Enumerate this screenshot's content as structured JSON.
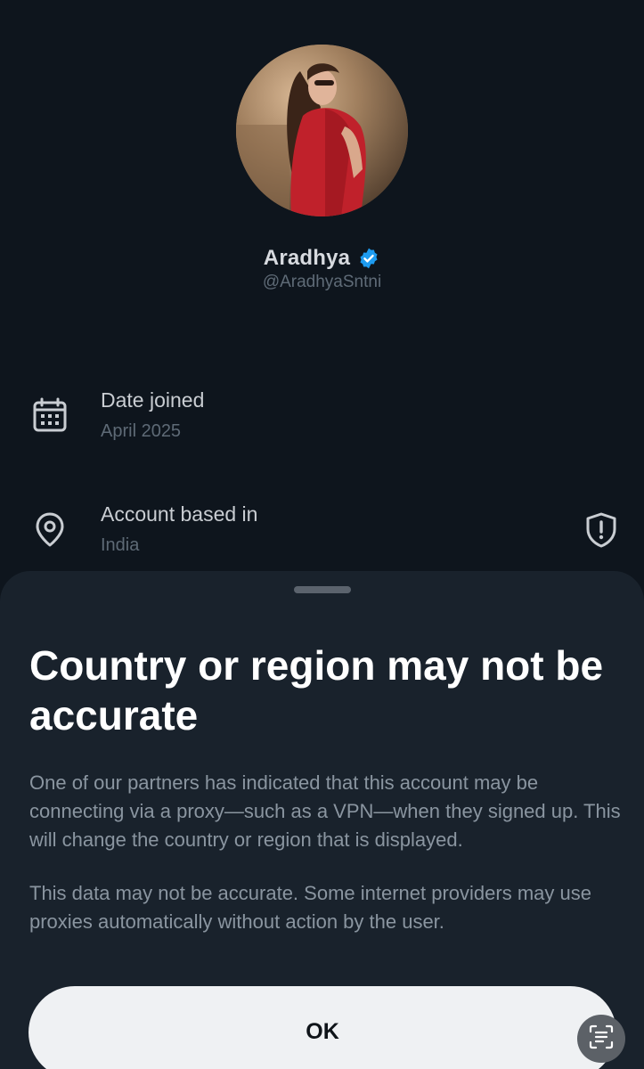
{
  "profile": {
    "name": "Aradhya",
    "handle": "@AradhyaSntni",
    "verified": true
  },
  "about": {
    "date_joined": {
      "title": "Date joined",
      "value": "April 2025",
      "icon": "calendar-icon"
    },
    "account_based_in": {
      "title": "Account based in",
      "value": "India",
      "icon": "location-pin-icon",
      "warning_icon": "shield-alert-icon"
    }
  },
  "sheet": {
    "title": "Country or region may not be accurate",
    "paragraph1": "One of our partners has indicated that this account may be connecting via a proxy—such as a VPN—when they signed up. This will change the country or region that is displayed.",
    "paragraph2": "This data may not be accurate. Some internet providers may use proxies automatically without action by the user.",
    "ok_label": "OK"
  },
  "overlay": {
    "lens_icon": "text-scan-icon"
  },
  "colors": {
    "background": "#0e151d",
    "sheet": "#19222c",
    "verified_blue": "#1d9bf0",
    "button": "#eff1f3"
  }
}
